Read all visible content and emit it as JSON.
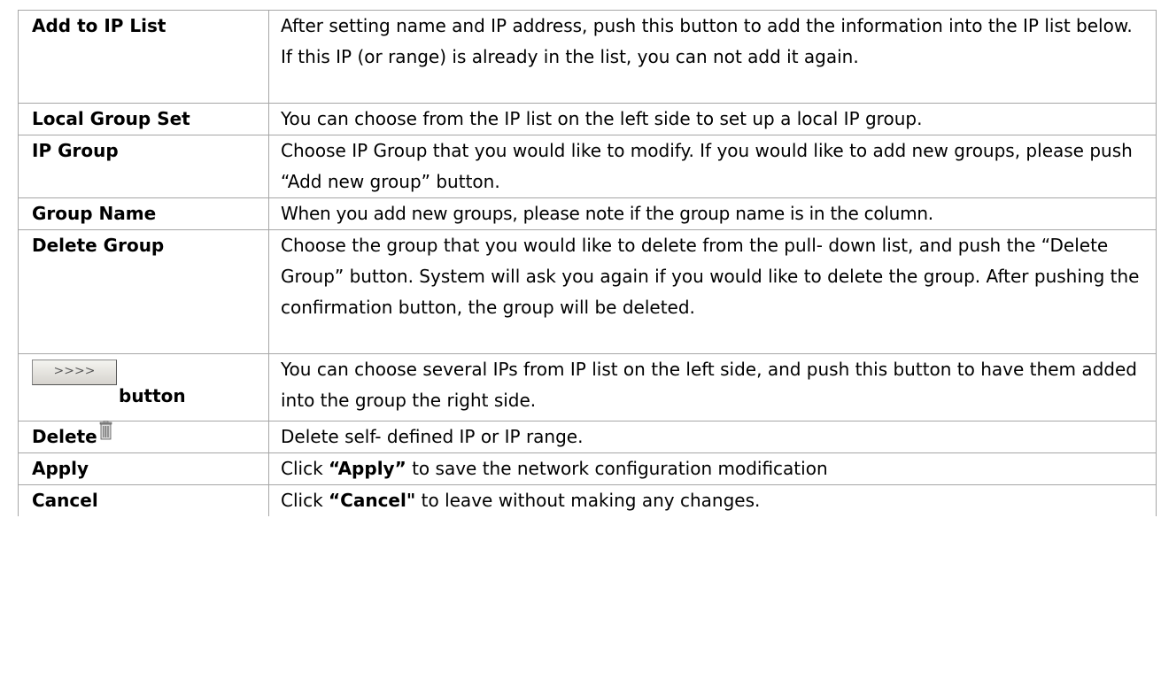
{
  "rows": [
    {
      "term": "Add to IP List",
      "desc": "After setting name and IP address, push this button to add the information into the IP list below. If this IP (or range) is already in the list, you can not add it again."
    },
    {
      "term": "Local Group Set",
      "desc": "You can choose from the IP list on the left side to set up a local IP group."
    },
    {
      "term": "IP Group",
      "desc": "Choose IP Group that you would like to modify. If you would like to add new groups, please push “Add new group” button."
    },
    {
      "term": "Group Name",
      "desc": "When you add new groups, please note if the group name is in the column."
    },
    {
      "term": "Delete Group",
      "desc": "Choose the group that you would like to delete from the pull- down list, and push the “Delete Group” button. System will ask you again if you would like to delete the group. After pushing the confirmation button, the group will be deleted."
    },
    {
      "term_button_glyph": ">>>>",
      "term": "button",
      "desc": "You can choose several IPs from IP list on the left side, and push this button to have them added into the group the right side."
    },
    {
      "term": "Delete",
      "icon": "trash-icon",
      "desc": "Delete self- defined IP or IP range."
    },
    {
      "term": "Apply",
      "desc_prefix": "Click ",
      "desc_bold": "“Apply”",
      "desc_suffix": " to save the network configuration modification"
    },
    {
      "term": "Cancel",
      "desc_prefix": "Click ",
      "desc_bold": "“Cancel\"",
      "desc_suffix": " to leave without making any changes."
    }
  ]
}
